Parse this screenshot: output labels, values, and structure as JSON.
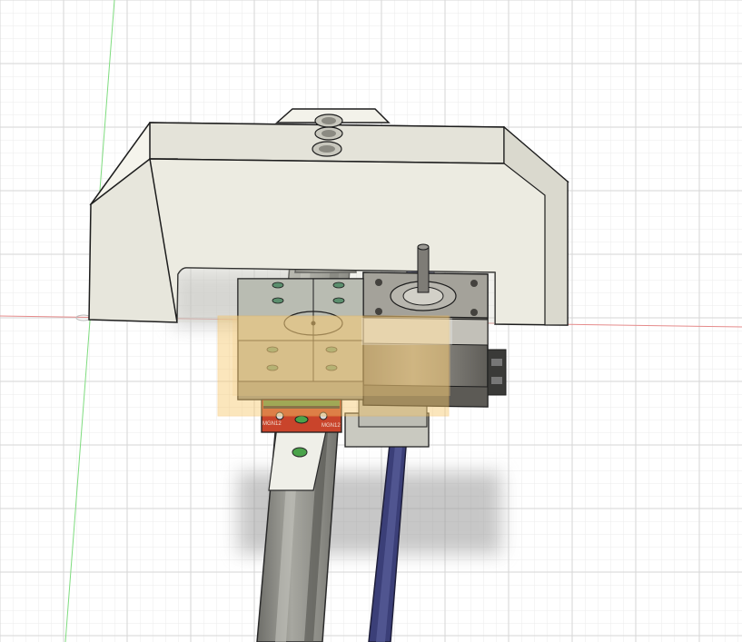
{
  "viewport": {
    "background": "#ffffff",
    "grid_minor_color": "#e6e6e6",
    "grid_major_color": "#cfcfcf",
    "axis_x_color": "#e07070",
    "axis_y_color": "#6fd96f"
  },
  "parts": {
    "bracket_color": "#ecebe2",
    "rail_color": "#8f8f8a",
    "belt_color": "#3b3f78",
    "motor_color": "#8c8a84",
    "carriage_color": "#a8a89d",
    "block_red": "#c9442b",
    "block_green": "#5a8f47",
    "selection_overlay": "#f6c76a"
  },
  "labels": {
    "block_marking_left": "MGN12",
    "block_marking_right": "MGN12"
  }
}
